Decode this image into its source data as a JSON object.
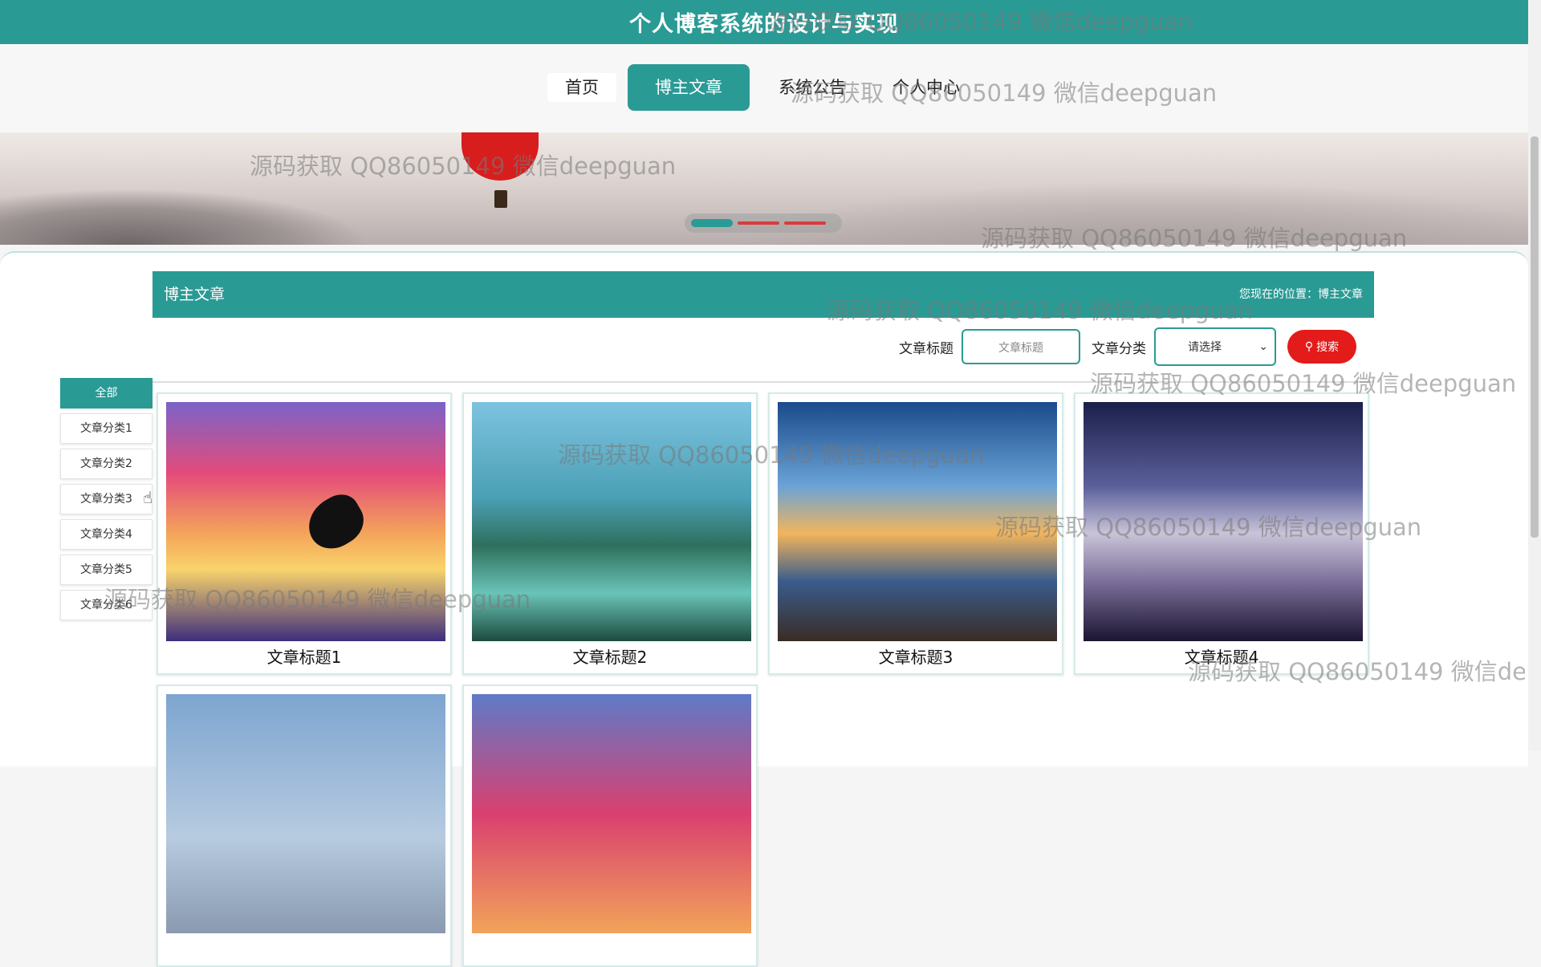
{
  "header": {
    "title": "个人博客系统的设计与实现"
  },
  "nav": {
    "items": [
      {
        "label": "首页"
      },
      {
        "label": "博主文章"
      },
      {
        "label": "系统公告"
      },
      {
        "label": "个人中心"
      }
    ],
    "active": "博主文章"
  },
  "section": {
    "title": "博主文章",
    "location": "您现在的位置：博主文章"
  },
  "search": {
    "title_label": "文章标题",
    "title_placeholder": "文章标题",
    "category_label": "文章分类",
    "category_value": "请选择",
    "button_label": "搜索"
  },
  "categories": [
    {
      "label": "全部"
    },
    {
      "label": "文章分类1"
    },
    {
      "label": "文章分类2"
    },
    {
      "label": "文章分类3"
    },
    {
      "label": "文章分类4"
    },
    {
      "label": "文章分类5"
    },
    {
      "label": "文章分类6"
    }
  ],
  "articles": [
    {
      "title": "文章标题1"
    },
    {
      "title": "文章标题2"
    },
    {
      "title": "文章标题3"
    },
    {
      "title": "文章标题4"
    },
    {
      "title": ""
    },
    {
      "title": ""
    }
  ],
  "watermark": "源码获取 QQ86050149 微信deepguan",
  "colors": {
    "primary": "#2a9a94",
    "search_button": "#e31b1b"
  }
}
